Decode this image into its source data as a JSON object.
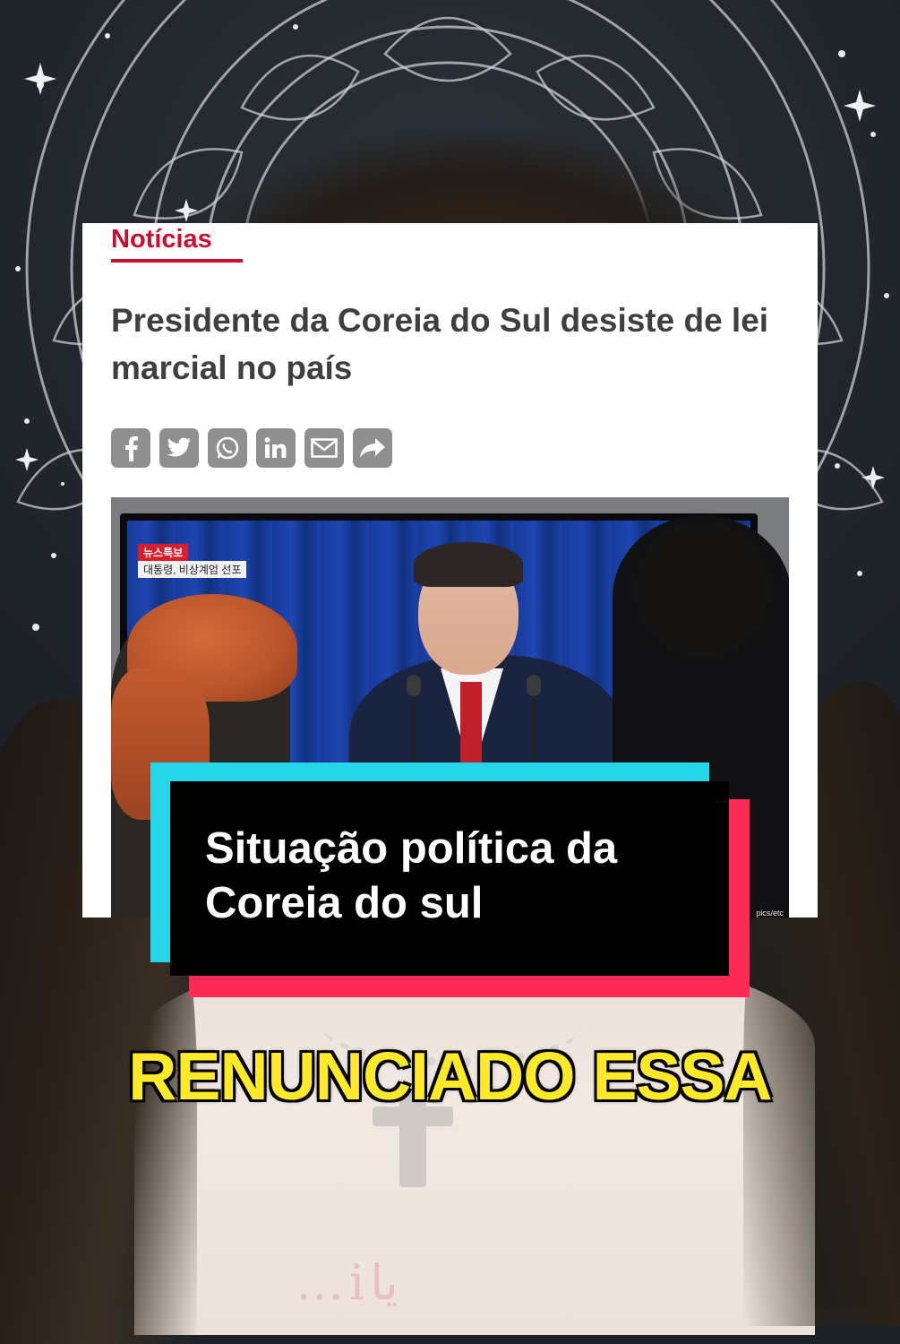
{
  "news_card": {
    "section_label": "Notícias",
    "headline": "Presidente da Coreia do Sul desiste de lei marcial no país",
    "share_icons": [
      "facebook-icon",
      "twitter-icon",
      "whatsapp-icon",
      "linkedin-icon",
      "mail-icon",
      "share-arrow-icon"
    ],
    "photo": {
      "ticker_tag": "뉴스특보",
      "ticker_text": "대통령, 비상계엄 선포",
      "credit": "pics/etc"
    }
  },
  "caption": {
    "text": "Situação política da Coreia do sul"
  },
  "subtitle": {
    "text": "RENUNCIADO ESSA"
  },
  "shirt_print": "…iيا",
  "colors": {
    "accent_red": "#c8102e",
    "caption_cyan": "#25d5e8",
    "caption_pink": "#fc2a55",
    "subtitle_yellow": "#ffea2a"
  }
}
